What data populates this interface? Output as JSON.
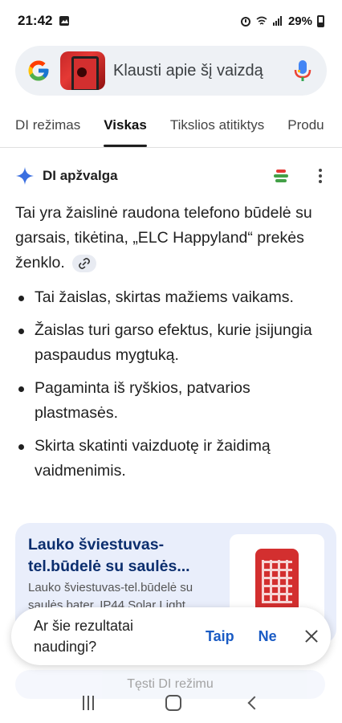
{
  "status": {
    "time": "21:42",
    "battery": "29%"
  },
  "search": {
    "placeholder": "Klausti apie šį vaizdą"
  },
  "tabs": [
    {
      "label": "DI režimas"
    },
    {
      "label": "Viskas"
    },
    {
      "label": "Tikslios atitiktys"
    },
    {
      "label": "Produ"
    }
  ],
  "ai": {
    "title": "DI apžvalga",
    "summary": "Tai yra žaislinė raudona telefono būdelė su garsais, tikėtina, „ELC Happyland“ prekės ženklo.",
    "bullets": [
      "Tai žaislas, skirtas mažiems vaikams.",
      "Žaislas turi garso efektus, kurie įsijungia paspaudus mygtuką.",
      "Pagaminta iš ryškios, patvarios plastmasės.",
      "Skirta skatinti vaizduotę ir žaidimą vaidmenimis."
    ]
  },
  "card": {
    "title": "Lauko šviestuvas-tel.būdelė su saulės...",
    "desc": "Lauko šviestuvas-tel.būdelė su saulės bater. IP44 Solar Light"
  },
  "feedback": {
    "question": "Ar šie rezultatai naudingi?",
    "yes": "Taip",
    "no": "Ne"
  },
  "ai_mode_button": "Tęsti DI režimu",
  "colors": {
    "accent": "#1a5bc4",
    "card_bg": "#e9eefb"
  }
}
